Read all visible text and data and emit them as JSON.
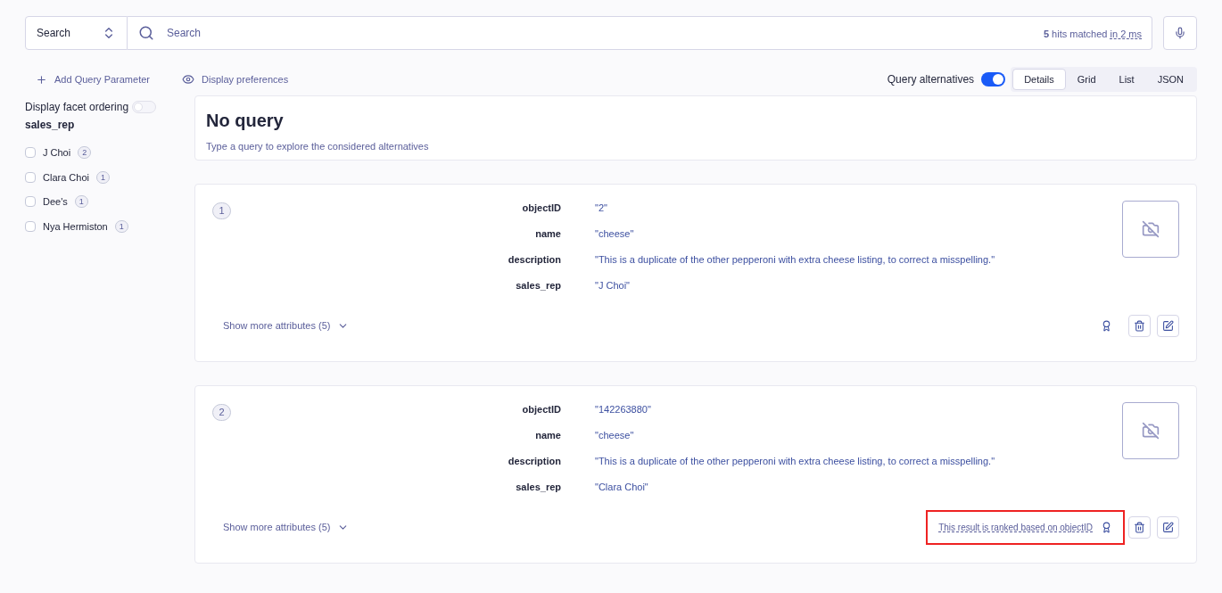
{
  "search": {
    "mode": "Search",
    "placeholder": "Search",
    "hits_count": "5",
    "hits_text": "hits matched",
    "time_text": "in 2 ms"
  },
  "toolbar": {
    "add_param": "Add Query Parameter",
    "display_prefs": "Display preferences",
    "alternatives_label": "Query alternatives",
    "alternatives_on": true,
    "views": [
      {
        "label": "Details",
        "selected": true
      },
      {
        "label": "Grid",
        "selected": false
      },
      {
        "label": "List",
        "selected": false
      },
      {
        "label": "JSON",
        "selected": false
      }
    ]
  },
  "facets": {
    "ordering_label": "Display facet ordering",
    "ordering_on": false,
    "attribute": "sales_rep",
    "items": [
      {
        "label": "J Choi",
        "count": "2",
        "checked": false
      },
      {
        "label": "Clara Choi",
        "count": "1",
        "checked": false
      },
      {
        "label": "Dee's",
        "count": "1",
        "checked": false
      },
      {
        "label": "Nya Hermiston",
        "count": "1",
        "checked": false
      }
    ]
  },
  "query_panel": {
    "title": "No query",
    "subtitle": "Type a query to explore the considered alternatives"
  },
  "hits": [
    {
      "index": "1",
      "attributes": [
        {
          "key": "objectID",
          "value": "\"2\""
        },
        {
          "key": "name",
          "value": "\"cheese\""
        },
        {
          "key": "description",
          "value": "\"This is a duplicate of the other pepperoni with extra cheese listing, to correct a misspelling.\""
        },
        {
          "key": "sales_rep",
          "value": "\"J Choi\""
        }
      ],
      "show_more": "Show more attributes (5)",
      "highlighted": false
    },
    {
      "index": "2",
      "attributes": [
        {
          "key": "objectID",
          "value": "\"142263880\""
        },
        {
          "key": "name",
          "value": "\"cheese\""
        },
        {
          "key": "description",
          "value": "\"This is a duplicate of the other pepperoni with extra cheese listing, to correct a misspelling.\""
        },
        {
          "key": "sales_rep",
          "value": "\"Clara Choi\""
        }
      ],
      "show_more": "Show more attributes (5)",
      "ranking_note": "This result is ranked based on objectID",
      "highlighted": true
    }
  ]
}
